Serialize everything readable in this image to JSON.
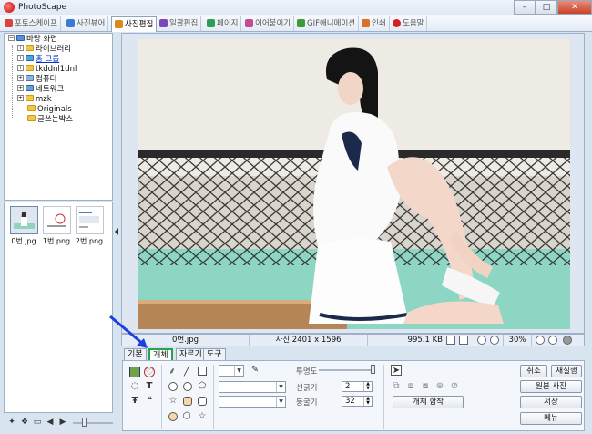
{
  "window": {
    "title": "PhotoScape",
    "min": "–",
    "max": "□",
    "close": "✕"
  },
  "tabs": [
    {
      "label": "포토스케이프",
      "icon": "photoscape-icon",
      "color": "#d9453a"
    },
    {
      "label": "사진뷰어",
      "icon": "viewer-icon",
      "color": "#3a7bd5"
    },
    {
      "label": "사진편집",
      "icon": "editor-icon",
      "color": "#d98a1f",
      "active": true
    },
    {
      "label": "일괄편집",
      "icon": "batch-icon",
      "color": "#7a4bb8"
    },
    {
      "label": "페이지",
      "icon": "page-icon",
      "color": "#2f9c5a"
    },
    {
      "label": "이어붙이기",
      "icon": "combine-icon",
      "color": "#c44a9a"
    },
    {
      "label": "GIF애니메이션",
      "icon": "gif-icon",
      "color": "#3c9c3a"
    },
    {
      "label": "인쇄",
      "icon": "print-icon",
      "color": "#d9702e"
    },
    {
      "label": "도움말",
      "icon": "help-icon",
      "color": "#d42020"
    }
  ],
  "tree": {
    "root": "바탕 화면",
    "items": [
      "라이브러리",
      "홈 그룹",
      "tkddnl1dnl",
      "컴퓨터",
      "네트워크",
      "mzk",
      "Originals",
      "글쓰는박스"
    ]
  },
  "thumbnails": [
    {
      "label": "0번.jpg"
    },
    {
      "label": "1번.png"
    },
    {
      "label": "2번.png"
    }
  ],
  "status": {
    "filename": "0번.jpg",
    "dimensions": "사진 2401 x 1596",
    "filesize": "995.1 KB",
    "zoom": "30%"
  },
  "editor_tabs": [
    "기본",
    "개체",
    "자르기",
    "도구"
  ],
  "editor_tab_active": 1,
  "object_panel": {
    "opacity_label": "투명도",
    "line_width_label": "선굵기",
    "line_width_value": "2",
    "roundness_label": "둥굴기",
    "roundness_value": "32",
    "merge_button": "개체 합착",
    "opacity_value": 1.0
  },
  "actions": {
    "undo": "취소",
    "redo": "재실행",
    "original": "원본 사진",
    "save": "저장",
    "menu": "메뉴"
  },
  "annotation_color": "#1f3fe0"
}
